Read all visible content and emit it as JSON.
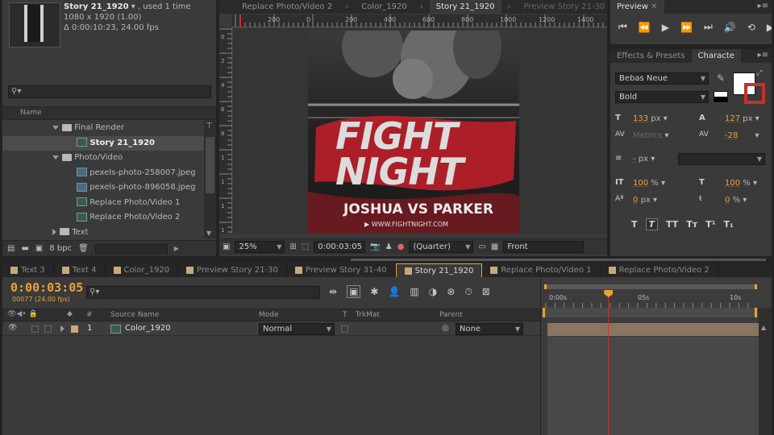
{
  "project": {
    "comp_name": "Story 21_1920",
    "used": ", used 1 time",
    "dimensions": "1080 x 1920 (1.00)",
    "duration": "Δ 0:00:10:23, 24.00 fps",
    "search_placeholder": "",
    "column_name": "Name",
    "items": [
      {
        "label": "Final Render",
        "type": "folder",
        "indent": 0
      },
      {
        "label": "Story 21_1920",
        "type": "comp",
        "indent": 1,
        "selected": true
      },
      {
        "label": "Photo/Video",
        "type": "folder",
        "indent": 0
      },
      {
        "label": "pexels-photo-258007.jpeg",
        "type": "image",
        "indent": 1
      },
      {
        "label": "pexels-photo-896058.jpeg",
        "type": "image",
        "indent": 1
      },
      {
        "label": "Replace Photo/Video 1",
        "type": "comp",
        "indent": 1
      },
      {
        "label": "Replace Photo/Video 2",
        "type": "comp",
        "indent": 1
      },
      {
        "label": "Text",
        "type": "folder-closed",
        "indent": 0
      }
    ],
    "bpc": "8 bpc"
  },
  "viewer": {
    "tabs": [
      "Replace Photo/Video 2",
      "Color_1920",
      "Story 21_1920",
      "Preview Story 21-30"
    ],
    "active_tab": 2,
    "ruler_labels": [
      "200",
      "0",
      "200",
      "400",
      "600",
      "800",
      "1000",
      "1200",
      "1400"
    ],
    "ruler_left_labels": [
      "0",
      "2",
      "4",
      "6",
      "8",
      "1000",
      "1200",
      "1400",
      "1600"
    ],
    "zoom": "25%",
    "timecode": "0:00:03:05",
    "resolution": "(Quarter)",
    "view": "Front",
    "poster": {
      "title_line1": "FIGHT",
      "title_line2": "NIGHT",
      "subtitle": "JOSHUA VS PARKER",
      "url": "WWW.FIGHTNIGHT.COM"
    }
  },
  "preview": {
    "tab": "Preview"
  },
  "character": {
    "tab_effects": "Effects & Presets",
    "tab_character": "Characte",
    "font": "Bebas Neue",
    "style": "Bold",
    "font_size": "133",
    "leading": "127",
    "kerning": "Metrics",
    "tracking": "-28",
    "stroke": "-",
    "vscale": "100",
    "hscale": "100",
    "baseline": "0",
    "tsume": "0",
    "unit_px": "px",
    "unit_pct": "%",
    "style_buttons": [
      "T",
      "T",
      "TT",
      "Tт",
      "T¹",
      "T₁"
    ]
  },
  "timeline": {
    "tabs": [
      "Text 3",
      "Text 4",
      "Color_1920",
      "Preview Story 21-30",
      "Preview Story 31-40",
      "Story 21_1920",
      "Replace Photo/Video 1",
      "Replace Photo/Video 2"
    ],
    "active_tab": 5,
    "timecode": "0:00:03:05",
    "fps": "00077 (24.00 fps)",
    "columns": {
      "num": "#",
      "source": "Source Name",
      "mode": "Mode",
      "t": "T",
      "trkmat": "TrkMat",
      "parent": "Parent"
    },
    "time_labels": [
      "0:00s",
      "05s",
      "10s"
    ],
    "layer": {
      "num": "1",
      "name": "Color_1920",
      "mode": "Normal",
      "parent": "None"
    },
    "playhead_fraction": 0.295
  },
  "colors": {
    "accent": "#e8a33a",
    "playhead": "#c8302a",
    "poster_red": "#c0242a"
  }
}
